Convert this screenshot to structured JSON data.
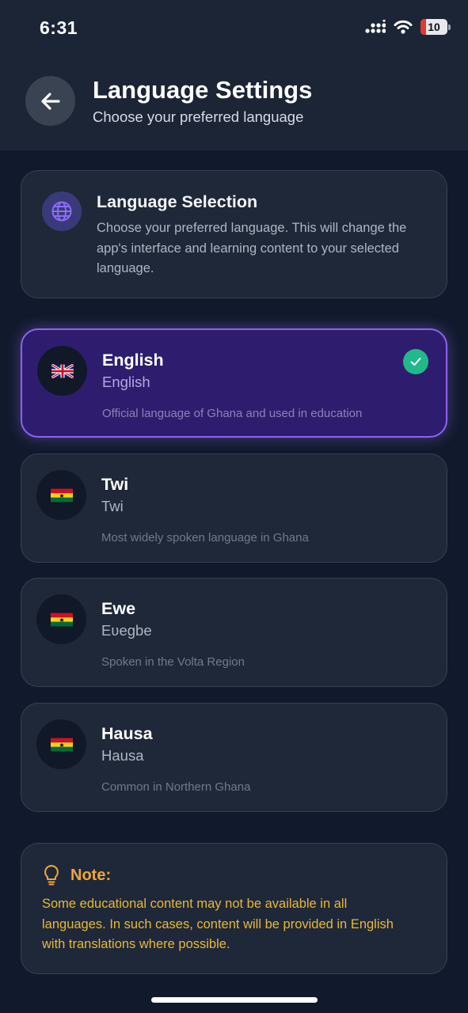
{
  "status_bar": {
    "time": "6:31",
    "battery_level": "10",
    "icons": [
      "signal-icon",
      "wifi-icon",
      "battery-icon"
    ]
  },
  "header": {
    "title": "Language Settings",
    "subtitle": "Choose your preferred language",
    "back_icon": "arrow-left-icon"
  },
  "info_card": {
    "icon": "globe-icon",
    "title": "Language Selection",
    "description": "Choose your preferred language. This will change the app's interface and learning content to your selected language."
  },
  "languages": [
    {
      "name": "English",
      "native": "English",
      "description": "Official language of Ghana and used in education",
      "flag": "🇬🇧",
      "selected": true
    },
    {
      "name": "Twi",
      "native": "Twi",
      "description": "Most widely spoken language in Ghana",
      "flag": "🇬🇭",
      "selected": false
    },
    {
      "name": "Ewe",
      "native": "Eʋegbe",
      "description": "Spoken in the Volta Region",
      "flag": "🇬🇭",
      "selected": false
    },
    {
      "name": "Hausa",
      "native": "Hausa",
      "description": "Common in Northern Ghana",
      "flag": "🇬🇭",
      "selected": false
    }
  ],
  "note": {
    "icon": "lightbulb-icon",
    "title": "Note:",
    "text": "Some educational content may not be available in all languages. In such cases, content will be provided in English with translations where possible."
  },
  "colors": {
    "background": "#111a2c",
    "card": "#1f2838",
    "selected_card": "#2e1d6e",
    "selected_border": "#8b63f0",
    "check": "#22b98a",
    "note_accent": "#f0a63a"
  }
}
